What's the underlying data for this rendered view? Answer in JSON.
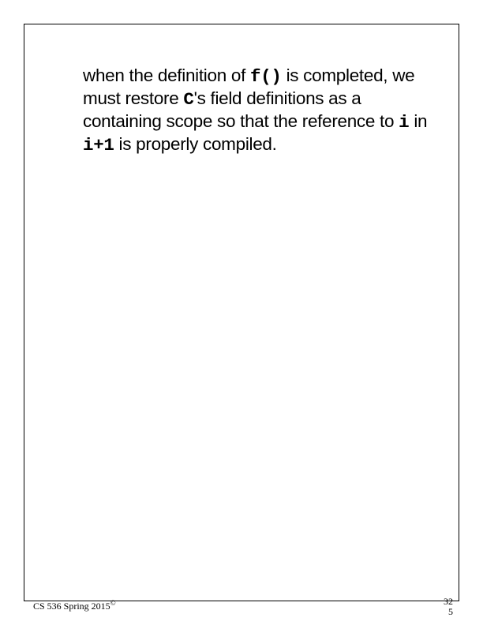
{
  "slide": {
    "text1": "when the definition of ",
    "code1": "f()",
    "text2": " is completed, we must restore ",
    "code2": "C",
    "text3": "'s field definitions as a containing scope so that the reference to ",
    "code3": "i",
    "text4": " in ",
    "code4": "i+1",
    "text5": " is properly compiled."
  },
  "footer": {
    "course": "CS 536  Spring 2015",
    "copyright": "©",
    "page_top": "32",
    "page_bottom": "5"
  }
}
